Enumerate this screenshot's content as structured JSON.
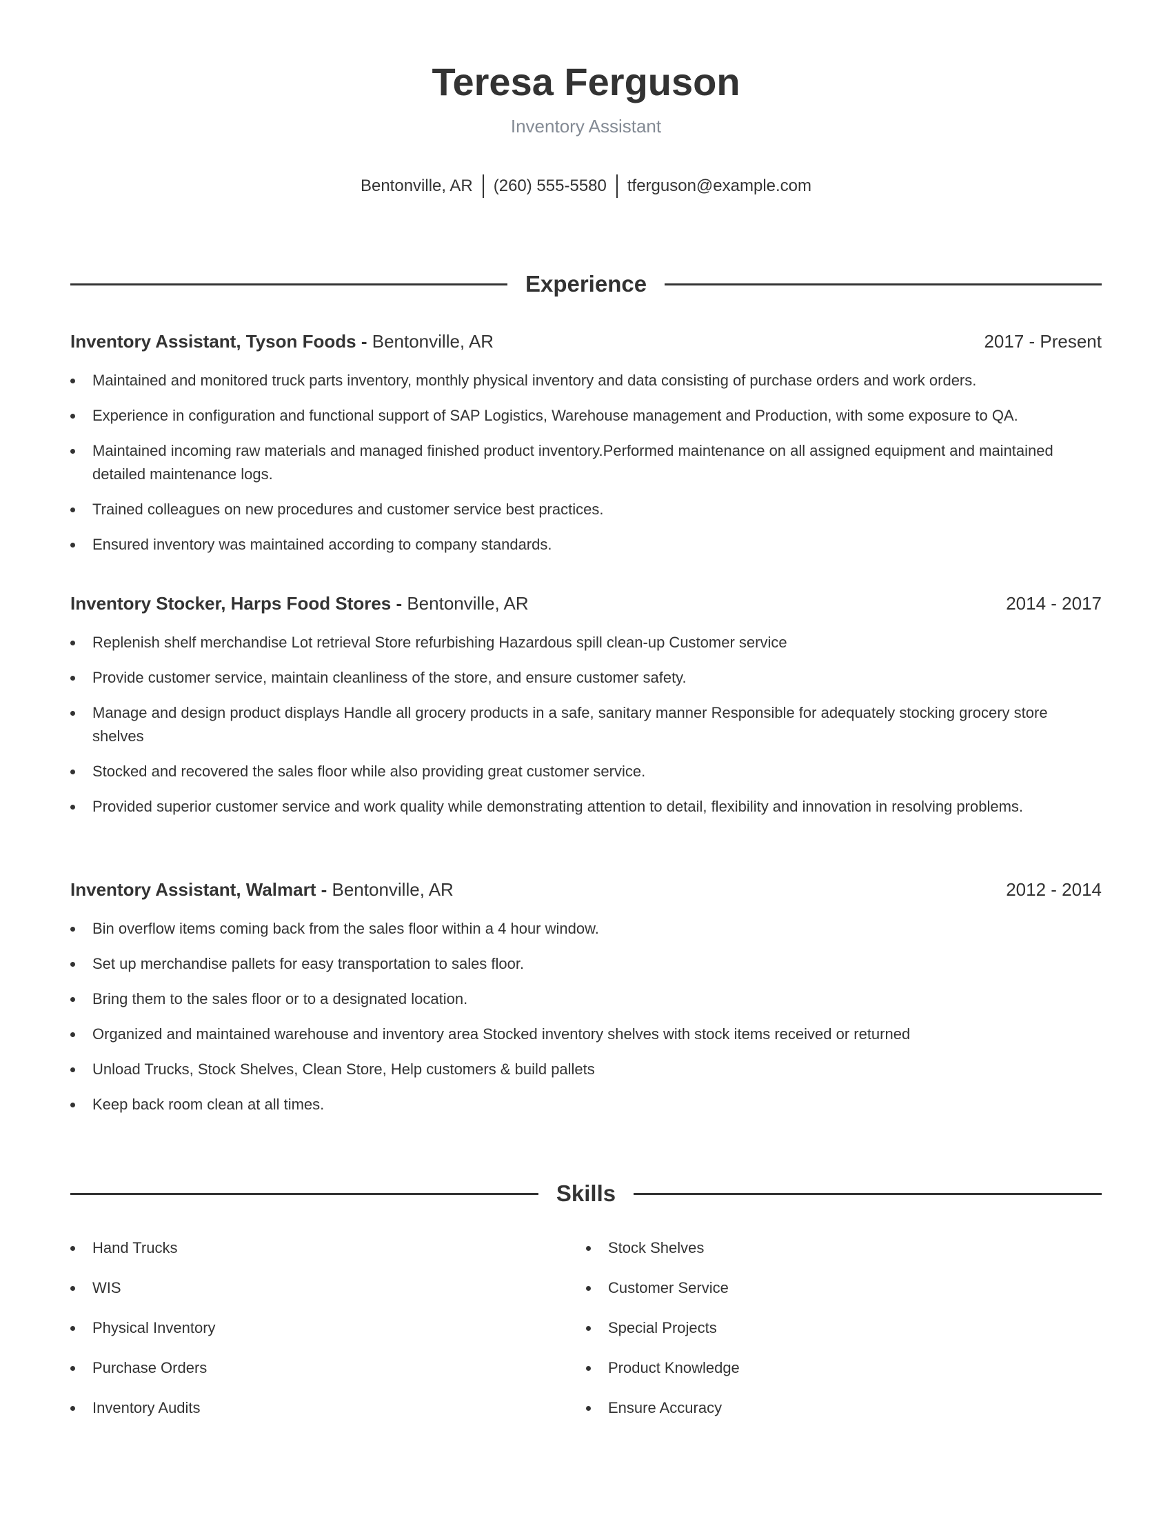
{
  "header": {
    "name": "Teresa Ferguson",
    "headline": "Inventory Assistant",
    "contact": {
      "location": "Bentonville, AR",
      "phone": "(260) 555-5580",
      "email": "tferguson@example.com"
    }
  },
  "experience": {
    "title": "Experience",
    "jobs": [
      {
        "role": "Inventory Assistant, Tyson Foods - ",
        "location": "Bentonville, AR",
        "dates": "2017 - Present",
        "bullets": [
          "Maintained and monitored truck parts inventory, monthly physical inventory and data consisting of purchase orders and work orders.",
          "Experience in configuration and functional support of SAP Logistics, Warehouse management and Production, with some exposure to QA.",
          "Maintained incoming raw materials and managed finished product inventory.Performed maintenance on all assigned equipment and maintained detailed maintenance logs.",
          "Trained colleagues on new procedures and customer service best practices.",
          "Ensured inventory was maintained according to company standards."
        ]
      },
      {
        "role": "Inventory Stocker, Harps Food Stores - ",
        "location": "Bentonville, AR",
        "dates": "2014 - 2017",
        "bullets": [
          "Replenish shelf merchandise Lot retrieval Store refurbishing Hazardous spill clean-up Customer service",
          "Provide customer service, maintain cleanliness of the store, and ensure customer safety.",
          "Manage and design product displays Handle all grocery products in a safe, sanitary manner Responsible for adequately stocking grocery store shelves",
          "Stocked and recovered the sales floor while also providing great customer service.",
          "Provided superior customer service and work quality while demonstrating attention to detail, flexibility and innovation in resolving problems."
        ]
      },
      {
        "role": "Inventory Assistant, Walmart - ",
        "location": "Bentonville, AR",
        "dates": "2012 - 2014",
        "bullets": [
          "Bin overflow items coming back from the sales floor within a 4 hour window.",
          "Set up merchandise pallets for easy transportation to sales floor.",
          "Bring them to the sales floor or to a designated location.",
          "Organized and maintained warehouse and inventory area Stocked inventory shelves with stock items received or returned",
          "Unload Trucks, Stock Shelves, Clean Store, Help customers & build pallets",
          "Keep back room clean at all times."
        ]
      }
    ]
  },
  "skills": {
    "title": "Skills",
    "left": [
      "Hand Trucks",
      "WIS",
      "Physical Inventory",
      "Purchase Orders",
      "Inventory Audits"
    ],
    "right": [
      "Stock Shelves",
      "Customer Service",
      "Special Projects",
      "Product Knowledge",
      "Ensure Accuracy"
    ]
  }
}
